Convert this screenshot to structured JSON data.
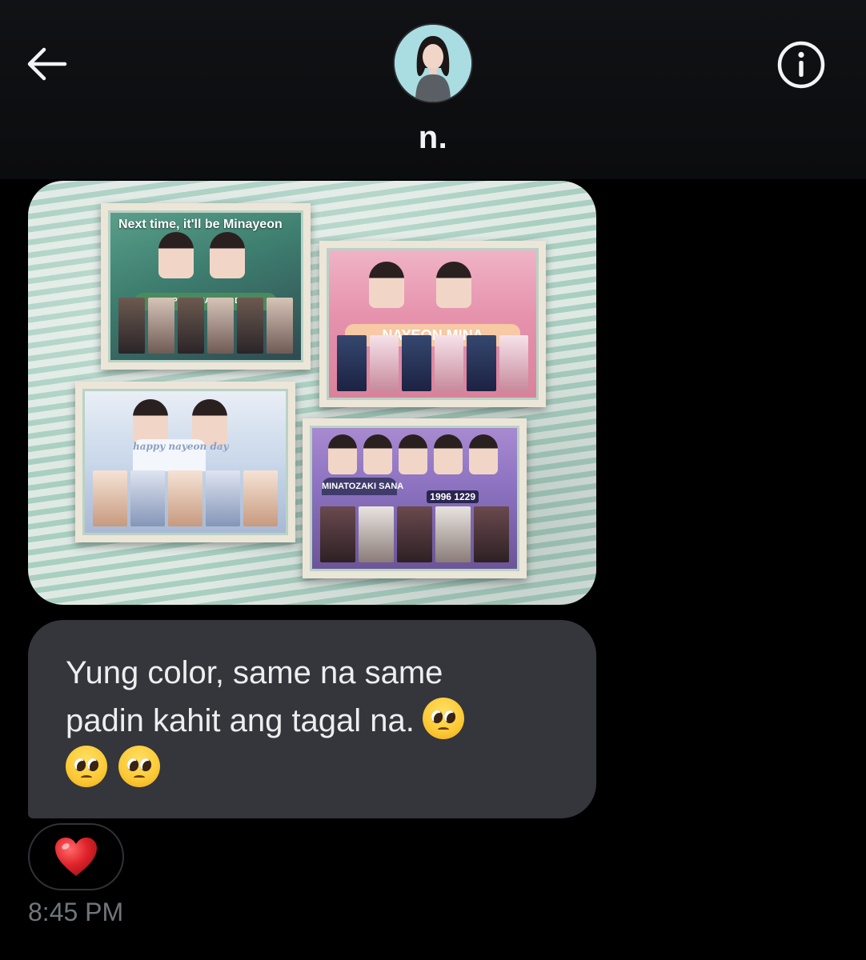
{
  "header": {
    "contact_name": "n.",
    "back_icon": "arrow-left-icon",
    "info_icon": "info-circle-icon",
    "avatar_icon": "profile-avatar"
  },
  "conversation": {
    "photo_message": {
      "frames": [
        {
          "title": "Next time, it'll be Minayeon",
          "ribbon": "HAPPY MINAYEON DAY"
        },
        {
          "title": "",
          "ribbon": "NAYEON  MINA"
        },
        {
          "title": "",
          "ribbon": "happy nayeon day"
        },
        {
          "title": "",
          "ribbon": "MINATOZAKI SANA",
          "date": "1996 1229"
        }
      ]
    },
    "text_message": {
      "line1": "Yung color, same na same",
      "line2": "padin kahit ang tagal na.",
      "emoji_name": "pleading-face-emoji",
      "emoji_count": 3
    },
    "reaction": {
      "emoji_name": "red-heart-emoji"
    },
    "timestamp": "8:45 PM"
  },
  "colors": {
    "background": "#000000",
    "header_bg": "#111215",
    "bubble_bg": "#34363b",
    "text": "#eceef0",
    "timestamp": "#71767b",
    "heart": "#e0242b",
    "pleading_face": "#fbc935"
  }
}
